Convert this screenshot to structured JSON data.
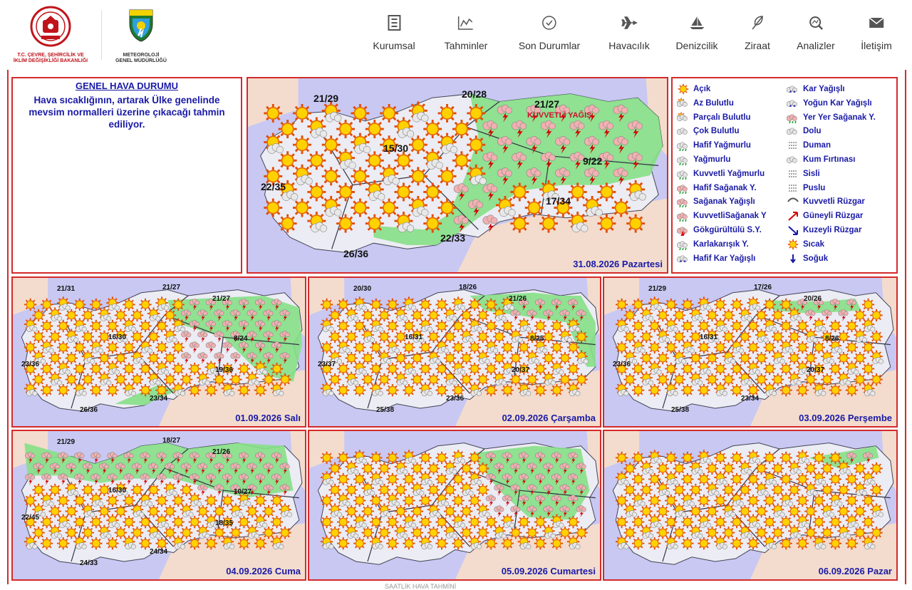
{
  "header": {
    "ministry_name": "T.C. ÇEVRE, ŞEHİRCİLİK VE İKLİM DEĞİŞİKLİĞİ BAKANLIĞI",
    "ministry_line1": "T.C. ÇEVRE, ŞEHİRCİLİK VE",
    "ministry_line2": "İKLİM DEĞİŞİKLİĞİ BAKANLIĞI",
    "mgm_line1": "METEOROLOJİ",
    "mgm_line2": "GENEL MÜDÜRLÜĞÜ",
    "nav": [
      {
        "label": "Kurumsal",
        "icon": "document-icon"
      },
      {
        "label": "Tahminler",
        "icon": "chart-icon"
      },
      {
        "label": "Son Durumlar",
        "icon": "check-circle-icon"
      },
      {
        "label": "Havacılık",
        "icon": "airplane-icon"
      },
      {
        "label": "Denizcilik",
        "icon": "sailboat-icon"
      },
      {
        "label": "Ziraat",
        "icon": "leaf-icon"
      },
      {
        "label": "Analizler",
        "icon": "analysis-icon"
      },
      {
        "label": "İletişim",
        "icon": "envelope-icon"
      }
    ]
  },
  "general": {
    "title": "GENEL HAVA DURUMU",
    "text": "Hava sıcaklığının, artarak Ülke genelinde mevsim normalleri üzerine çıkacağı tahmin ediliyor."
  },
  "colors": {
    "sea": "#c8c8f2",
    "land": "#ececf4",
    "neighbor": "#f3dccd",
    "rain": "#86e086",
    "border": "#d42a2a",
    "text": "#1a1aa6"
  },
  "main_map": {
    "date": "31.08.2026 Pazartesi",
    "label_heavy_rain": "KUVVETLİ YAĞIŞ",
    "temps": [
      "21/29",
      "20/28",
      "21/27",
      "15/30",
      "9/22",
      "22/35",
      "17/34",
      "22/33",
      "26/36"
    ]
  },
  "maps": [
    {
      "date": "01.09.2026 Salı",
      "temps": [
        "21/31",
        "21/27",
        "21/27",
        "16/30",
        "8/24",
        "23/36",
        "19/36",
        "23/34",
        "26/36"
      ]
    },
    {
      "date": "02.09.2026 Çarşamba",
      "temps": [
        "20/30",
        "18/26",
        "21/26",
        "16/31",
        "8/25",
        "23/37",
        "20/37",
        "23/36",
        "25/38"
      ]
    },
    {
      "date": "03.09.2026 Perşembe",
      "temps": [
        "21/29",
        "17/26",
        "20/26",
        "16/31",
        "8/26",
        "23/36",
        "20/37",
        "23/34",
        "25/38"
      ]
    },
    {
      "date": "04.09.2026 Cuma",
      "temps": [
        "21/29",
        "18/27",
        "21/26",
        "16/30",
        "10/27",
        "22/45",
        "18/35",
        "24/34",
        "24/33"
      ]
    },
    {
      "date": "05.09.2026 Cumartesi",
      "temps": []
    },
    {
      "date": "06.09.2026 Pazar",
      "temps": []
    }
  ],
  "legend": {
    "col1": [
      {
        "label": "Açık",
        "icon": "sun-icon"
      },
      {
        "label": "Az Bulutlu",
        "icon": "sun-cloud-icon"
      },
      {
        "label": "Parçalı Bulutlu",
        "icon": "partly-cloudy-icon"
      },
      {
        "label": "Çok Bulutlu",
        "icon": "cloudy-icon"
      },
      {
        "label": "Hafif Yağmurlu",
        "icon": "light-rain-icon"
      },
      {
        "label": "Yağmurlu",
        "icon": "rain-icon"
      },
      {
        "label": "Kuvvetli Yağmurlu",
        "icon": "heavy-rain-icon"
      },
      {
        "label": "Hafif Sağanak Y.",
        "icon": "light-shower-icon"
      },
      {
        "label": "Sağanak Yağışlı",
        "icon": "shower-icon"
      },
      {
        "label": "KuvvetliSağanak Y",
        "icon": "heavy-shower-icon"
      },
      {
        "label": "Gökgürültülü S.Y.",
        "icon": "thunderstorm-icon"
      },
      {
        "label": "Karlakarışık Y.",
        "icon": "sleet-icon"
      },
      {
        "label": "Hafif Kar Yağışlı",
        "icon": "light-snow-icon"
      }
    ],
    "col2": [
      {
        "label": "Kar Yağışlı",
        "icon": "snow-icon"
      },
      {
        "label": "Yoğun Kar Yağışlı",
        "icon": "heavy-snow-icon"
      },
      {
        "label": "Yer Yer Sağanak Y.",
        "icon": "local-shower-icon"
      },
      {
        "label": "Dolu",
        "icon": "hail-icon"
      },
      {
        "label": "Duman",
        "icon": "smoke-icon"
      },
      {
        "label": "Kum Fırtınası",
        "icon": "sandstorm-icon"
      },
      {
        "label": "Sisli",
        "icon": "fog-icon"
      },
      {
        "label": "Puslu",
        "icon": "haze-icon"
      },
      {
        "label": "Kuvvetli Rüzgar",
        "icon": "strong-wind-icon"
      },
      {
        "label": "Güneyli Rüzgar",
        "icon": "south-wind-icon"
      },
      {
        "label": "Kuzeyli Rüzgar",
        "icon": "north-wind-icon"
      },
      {
        "label": "Sıcak",
        "icon": "hot-icon"
      },
      {
        "label": "Soğuk",
        "icon": "cold-icon"
      }
    ]
  },
  "footer": {
    "text": "SAATLİK HAVA TAHMİNİ"
  }
}
